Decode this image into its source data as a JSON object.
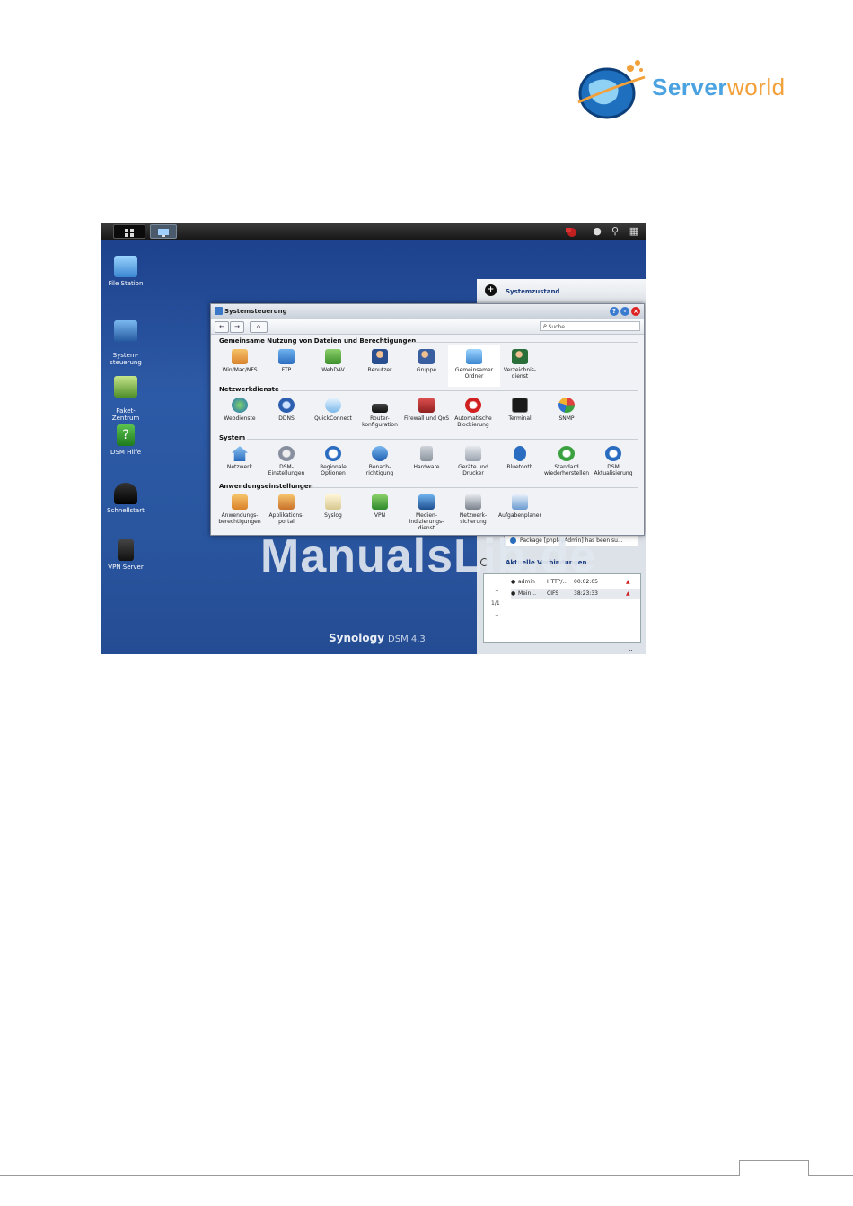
{
  "logo": {
    "part1": "Server",
    "part2": "world"
  },
  "watermark": "ManualsLib.de",
  "desktop_icons": [
    {
      "label": "File Station",
      "icon": "file-station-icon"
    },
    {
      "label": "System-\nsteuerung",
      "icon": "control-panel-icon"
    },
    {
      "label": "Paket-\nZentrum",
      "icon": "package-center-icon"
    },
    {
      "label": "DSM Hilfe",
      "icon": "help-icon"
    },
    {
      "label": "Schnellstart",
      "icon": "quickstart-icon"
    },
    {
      "label": "VPN Server",
      "icon": "vpn-server-icon"
    }
  ],
  "right_panel": {
    "title": "Systemzustand"
  },
  "notification": {
    "text": "Package [phpMyAdmin] has been su..."
  },
  "connections": {
    "title": "Aktuelle Verbindungen",
    "page": "1/1",
    "rows": [
      {
        "user": "admin",
        "protocol": "HTTP/...",
        "time": "00:02:05"
      },
      {
        "user": "Mein...",
        "protocol": "CIFS",
        "time": "38:23:33"
      }
    ]
  },
  "brand": {
    "name": "Synology",
    "version": "DSM 4.3"
  },
  "window": {
    "title": "Systemsteuerung",
    "search_placeholder": "Suche",
    "sections": [
      {
        "title": "Gemeinsame Nutzung von Dateien und Berechtigungen",
        "items": [
          "Win/Mac/NFS",
          "FTP",
          "WebDAV",
          "Benutzer",
          "Gruppe",
          "Gemeinsamer Ordner",
          "Verzeichnis-dienst"
        ]
      },
      {
        "title": "Netzwerkdienste",
        "items": [
          "Webdienste",
          "DDNS",
          "QuickConnect",
          "Router-konfiguration",
          "Firewall und QoS",
          "Automatische Blockierung",
          "Terminal",
          "SNMP"
        ]
      },
      {
        "title": "System",
        "items": [
          "Netzwerk",
          "DSM-Einstellungen",
          "Regionale Optionen",
          "Benach-richtigung",
          "Hardware",
          "Geräte und Drucker",
          "Bluetooth",
          "Standard wiederherstellen",
          "DSM Aktualisierung"
        ]
      },
      {
        "title": "Anwendungseinstellungen",
        "items": [
          "Anwendungs-berechtigungen",
          "Applikations-portal",
          "Syslog",
          "VPN",
          "Medien-indizierungs-dienst",
          "Netzwerk-sicherung",
          "Aufgabenplaner"
        ]
      }
    ]
  },
  "colors": {
    "desktop": "#2a56a0",
    "accent": "#1a3c80",
    "logo_blue": "#4aa3e0",
    "logo_orange": "#f2a03a"
  }
}
